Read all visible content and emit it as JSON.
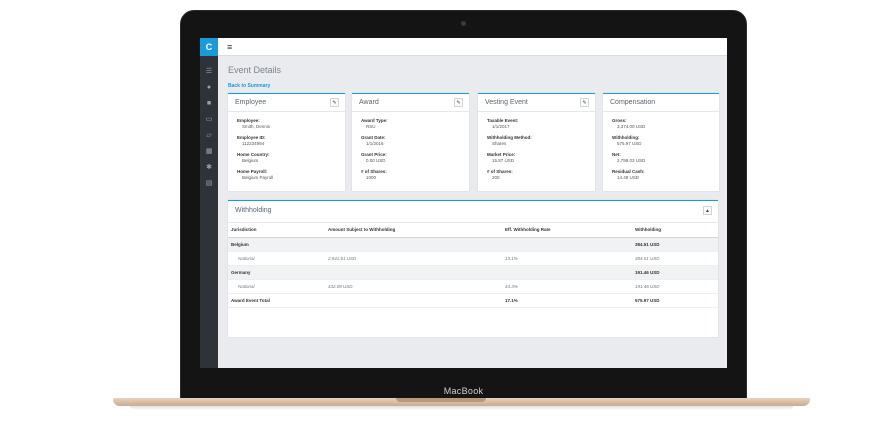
{
  "device": {
    "brand": "MacBook"
  },
  "sidebar": {
    "logo": "C",
    "items": [
      {
        "icon": "list-icon",
        "glyph": "☰"
      },
      {
        "icon": "user-icon",
        "glyph": "●"
      },
      {
        "icon": "briefcase-icon",
        "glyph": "■"
      },
      {
        "icon": "document-icon",
        "glyph": "▭"
      },
      {
        "icon": "folder-icon",
        "glyph": "▱"
      },
      {
        "icon": "building-icon",
        "glyph": "▦"
      },
      {
        "icon": "gear-icon",
        "glyph": "✱"
      },
      {
        "icon": "table-icon",
        "glyph": "▤"
      }
    ]
  },
  "topbar": {
    "menu_glyph": "≡"
  },
  "page": {
    "title": "Event Details",
    "back_link": "Back to Summary"
  },
  "cards": {
    "employee": {
      "title": "Employee",
      "fields": [
        {
          "label": "Employee:",
          "value": "Smith, Dennis"
        },
        {
          "label": "Employee ID:",
          "value": "112234994"
        },
        {
          "label": "Home Country:",
          "value": "Belgium"
        },
        {
          "label": "Home Payroll:",
          "value": "Belgium Payroll"
        }
      ]
    },
    "award": {
      "title": "Award",
      "fields": [
        {
          "label": "Award Type:",
          "value": "RSU"
        },
        {
          "label": "Grant Date:",
          "value": "1/1/2016"
        },
        {
          "label": "Grant Price:",
          "value": "0.00 USD"
        },
        {
          "label": "# of Shares:",
          "value": "1000"
        }
      ]
    },
    "vesting": {
      "title": "Vesting Event",
      "fields": [
        {
          "label": "Taxable Event:",
          "value": "1/1/2017"
        },
        {
          "label": "Withholding Method:",
          "value": "Shares"
        },
        {
          "label": "Market Price:",
          "value": "15.87 USD"
        },
        {
          "label": "# of Shares:",
          "value": "200"
        }
      ]
    },
    "compensation": {
      "title": "Compensation",
      "fields": [
        {
          "label": "Gross:",
          "value": "3,374.00 USD"
        },
        {
          "label": "Withholding:",
          "value": "575.97 USD"
        },
        {
          "label": "Net:",
          "value": "2,798.03 USD"
        },
        {
          "label": "Residual Cash:",
          "value": "14.48 USD"
        }
      ]
    }
  },
  "withholding": {
    "title": "Withholding",
    "columns": [
      "Jurisdiction",
      "Amount Subject to Withholding",
      "Eff. Withholding Rate",
      "Withholding"
    ],
    "rows": [
      {
        "type": "group",
        "cells": [
          "Belgium",
          "",
          "",
          "384.51 USD"
        ]
      },
      {
        "type": "sub",
        "cells": [
          "National",
          "2,841.61 USD",
          "13.1%",
          "384.51 USD"
        ]
      },
      {
        "type": "group",
        "cells": [
          "Germany",
          "",
          "",
          "191.46 USD"
        ]
      },
      {
        "type": "sub",
        "cells": [
          "National",
          "432.09 USD",
          "44.3%",
          "191.46 USD"
        ]
      },
      {
        "type": "total",
        "cells": [
          "Award Event Total",
          "",
          "17.1%",
          "575.97 USD"
        ]
      }
    ]
  }
}
